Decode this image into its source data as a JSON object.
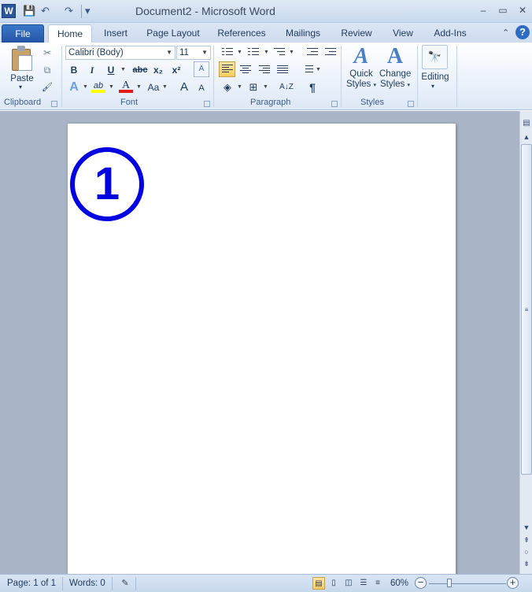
{
  "window": {
    "title": "Document2  -  Microsoft Word",
    "app_icon_letter": "W",
    "controls": {
      "minimize": "–",
      "restore": "▭",
      "close": "✕"
    }
  },
  "quick_access": {
    "save": "💾",
    "undo": "↶",
    "redo": "↷",
    "customize": "▾"
  },
  "tabs": [
    {
      "label": "File"
    },
    {
      "label": "Home"
    },
    {
      "label": "Insert"
    },
    {
      "label": "Page Layout"
    },
    {
      "label": "References"
    },
    {
      "label": "Mailings"
    },
    {
      "label": "Review"
    },
    {
      "label": "View"
    },
    {
      "label": "Add-Ins"
    }
  ],
  "ribbon_controls": {
    "minimize": "⌃",
    "help": "?"
  },
  "ribbon": {
    "clipboard": {
      "group_label": "Clipboard",
      "paste_label": "Paste",
      "paste_arrow": "▾",
      "cut": "✂",
      "copy": "⧉",
      "format_painter": "🖌"
    },
    "font": {
      "group_label": "Font",
      "font_name": "Calibri (Body)",
      "font_size": "11",
      "bold": "B",
      "italic": "I",
      "underline": "U",
      "strikethrough": "abc",
      "subscript": "x₂",
      "superscript": "x²",
      "text_effects": "A",
      "highlight": "ab",
      "font_color": "A",
      "change_case": "Aa",
      "grow": "A",
      "shrink": "A",
      "clear_format": "A"
    },
    "paragraph": {
      "group_label": "Paragraph",
      "show_marks": "¶",
      "sort": "A↓Z"
    },
    "styles": {
      "group_label": "Styles",
      "quick_styles_line1": "Quick",
      "quick_styles_line2": "Styles",
      "change_styles_line1": "Change",
      "change_styles_line2": "Styles",
      "dropdown_arrow": "▾"
    },
    "editing": {
      "label": "Editing",
      "dropdown_arrow": "▾",
      "icon": "🔭"
    }
  },
  "document": {
    "content": "1"
  },
  "status_bar": {
    "page": "Page: 1 of 1",
    "words": "Words: 0",
    "zoom": "60%",
    "zoom_minus": "−",
    "zoom_plus": "+"
  },
  "colors": {
    "accent": "#2b579a",
    "circle_number": "#0000e1",
    "ribbon_selected": "#f9cd5f"
  }
}
